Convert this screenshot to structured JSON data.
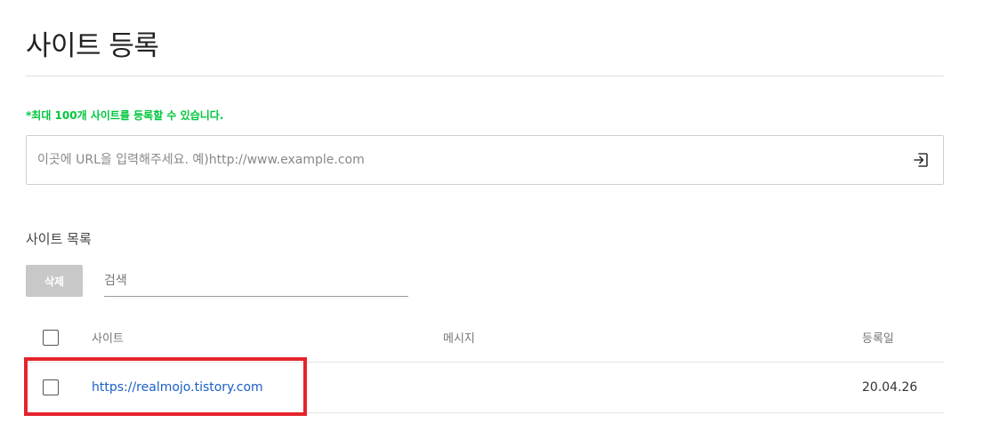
{
  "page": {
    "title": "사이트 등록"
  },
  "register": {
    "notice": "*최대 100개 사이트를 등록할 수 있습니다.",
    "url_placeholder": "이곳에 URL을 입력해주세요. 예)http://www.example.com",
    "url_value": "",
    "submit_icon": "enter-icon"
  },
  "list": {
    "title": "사이트 목록",
    "delete_label": "삭제",
    "search_placeholder": "검색",
    "columns": {
      "site": "사이트",
      "message": "메시지",
      "date": "등록일"
    },
    "rows": [
      {
        "site": "https://realmojo.tistory.com",
        "message": "",
        "date": "20.04.26",
        "checked": false
      }
    ]
  },
  "colors": {
    "notice": "#00c73c",
    "link": "#1b5fc6",
    "delete_button_bg": "#c8c8c8",
    "highlight": "#e5232d"
  }
}
